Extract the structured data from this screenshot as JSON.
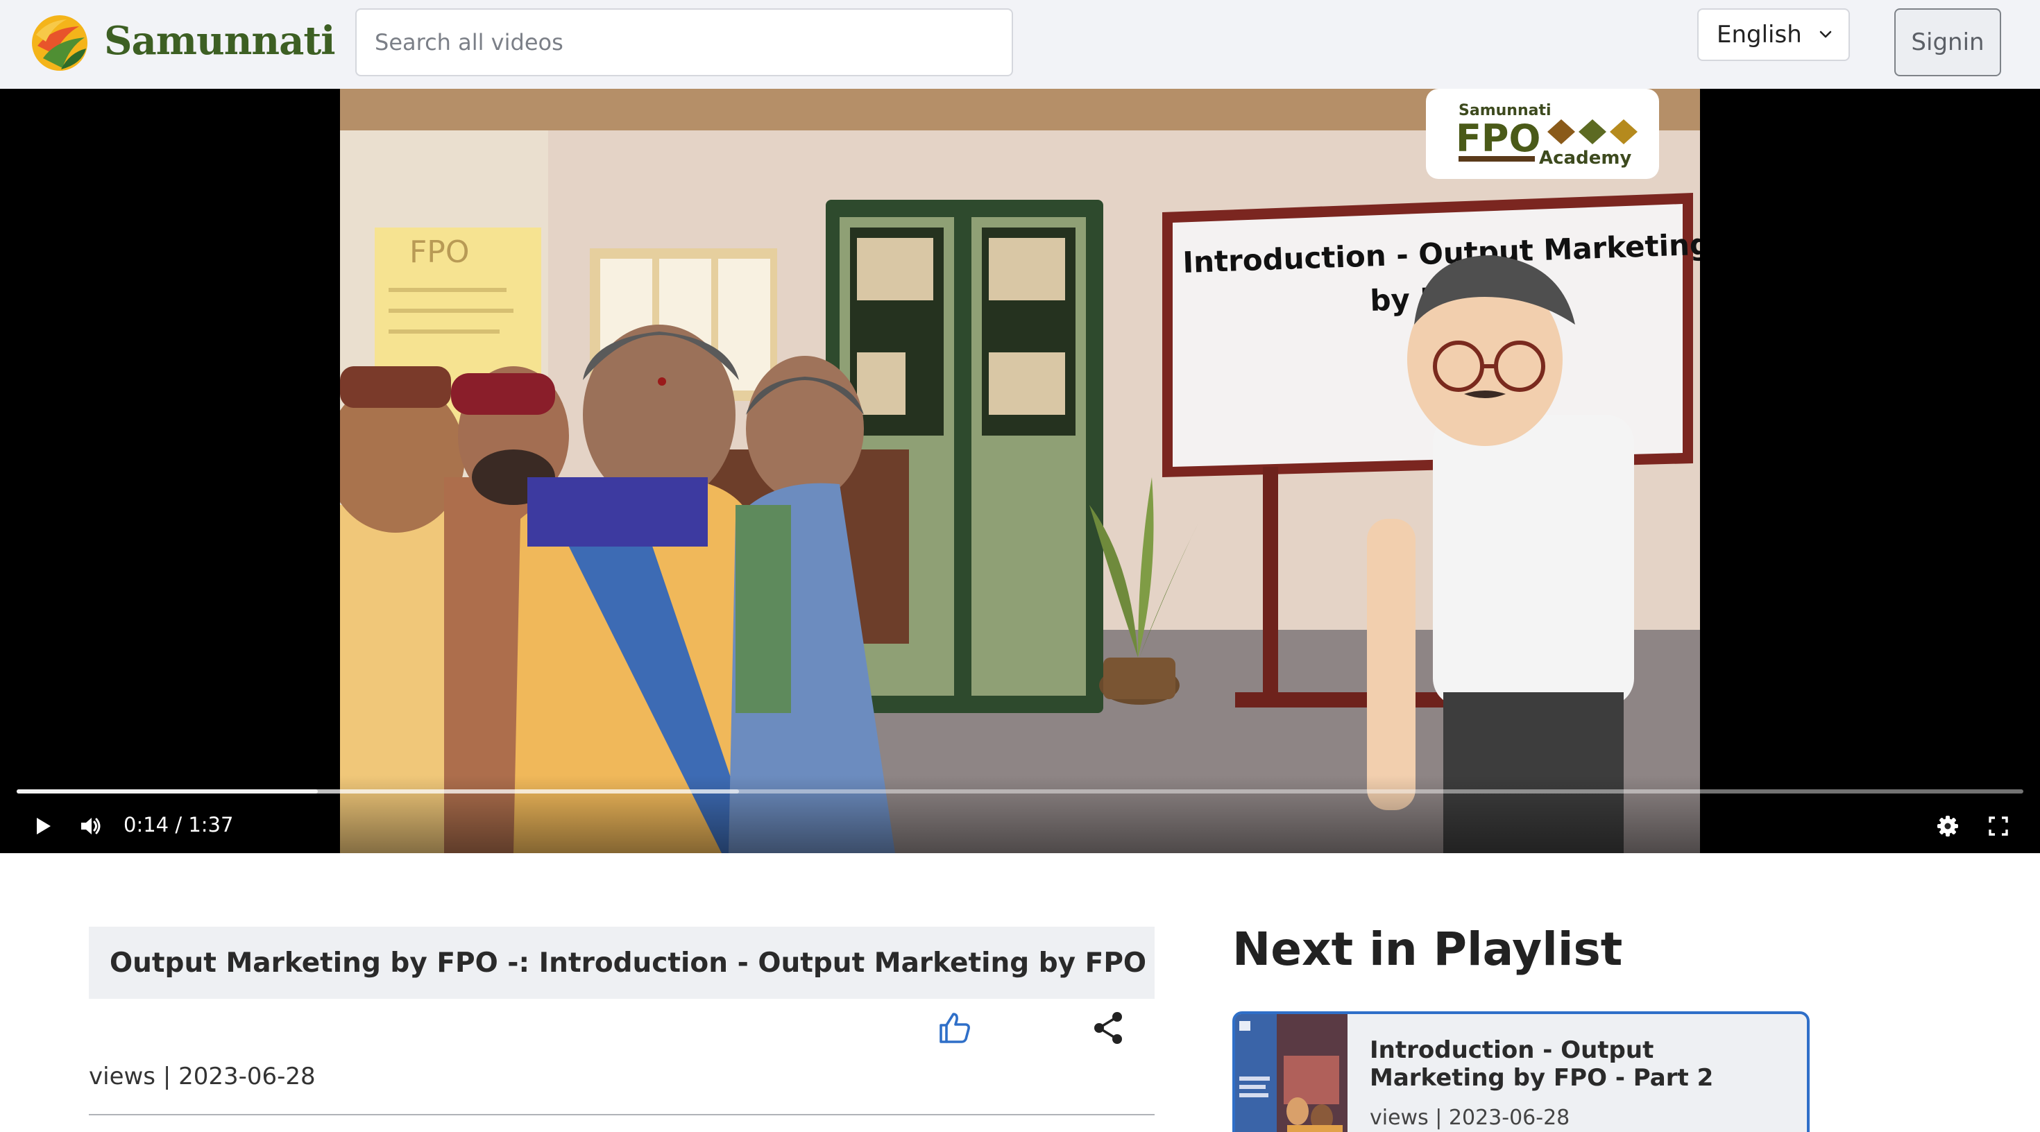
{
  "header": {
    "brand": "Samunnati",
    "search_placeholder": "Search all videos",
    "language": "English",
    "signin_label": "Signin"
  },
  "video": {
    "slide_title_line1": "Introduction - Output Marketing",
    "slide_title_line2": "by FPO",
    "academy_brand_small": "Samunnati",
    "academy_brand_big": "FPO",
    "academy_brand_sub": "Academy",
    "poster_text": "FPO",
    "time_display": "0:14 / 1:37",
    "played_fraction": 0.15,
    "buffered_fraction": 0.36
  },
  "info": {
    "title_part1": "Output Marketing by FPO -",
    "title_part2": ": Introduction - Output Marketing by FPO ...",
    "meta": "views | 2023-06-28"
  },
  "playlist": {
    "heading": "Next in Playlist",
    "items": [
      {
        "title": "Introduction - Output Marketing by FPO - Part 2",
        "meta": "views | 2023-06-28"
      }
    ]
  },
  "colors": {
    "brand_green": "#3d5f23",
    "accent_blue": "#2f6fc8",
    "header_bg": "#f2f3f7"
  },
  "icons": {
    "logo": "samunnati-logo-icon",
    "language_dropdown": "chevron-down-icon",
    "play": "play-icon",
    "volume": "volume-icon",
    "settings": "gear-icon",
    "fullscreen": "fullscreen-icon",
    "like": "thumbs-up-icon",
    "share": "share-icon"
  }
}
